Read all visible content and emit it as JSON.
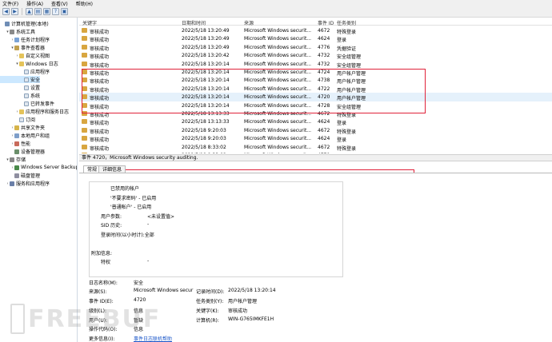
{
  "menu": [
    "文件(F)",
    "操作(A)",
    "查看(V)",
    "帮助(H)"
  ],
  "tree": [
    {
      "label": "计算机管理(本地)",
      "icon": "computer-icon",
      "indent": 0,
      "exp": ""
    },
    {
      "label": "系统工具",
      "icon": "tools-icon",
      "indent": 1,
      "exp": "▾"
    },
    {
      "label": "任务计划程序",
      "icon": "task-scheduler-icon",
      "indent": 2,
      "exp": "›"
    },
    {
      "label": "事件查看器",
      "icon": "event-viewer-icon",
      "indent": 2,
      "exp": "▾"
    },
    {
      "label": "自定义视图",
      "icon": "folder-icon",
      "indent": 3,
      "exp": "›"
    },
    {
      "label": "Windows 日志",
      "icon": "folder-icon",
      "indent": 3,
      "exp": "▾"
    },
    {
      "label": "应用程序",
      "icon": "log-icon",
      "indent": 4,
      "exp": ""
    },
    {
      "label": "安全",
      "icon": "log-icon",
      "indent": 4,
      "exp": "",
      "selected": true
    },
    {
      "label": "设置",
      "icon": "log-icon",
      "indent": 4,
      "exp": ""
    },
    {
      "label": "系统",
      "icon": "log-icon",
      "indent": 4,
      "exp": ""
    },
    {
      "label": "已转发事件",
      "icon": "log-icon",
      "indent": 4,
      "exp": ""
    },
    {
      "label": "应用程序和服务日志",
      "icon": "folder-icon",
      "indent": 3,
      "exp": "›"
    },
    {
      "label": "订阅",
      "icon": "log-icon",
      "indent": 3,
      "exp": ""
    },
    {
      "label": "共享文件夹",
      "icon": "shared-folder-icon",
      "indent": 2,
      "exp": "›"
    },
    {
      "label": "本地用户和组",
      "icon": "users-icon",
      "indent": 2,
      "exp": "›"
    },
    {
      "label": "性能",
      "icon": "performance-icon",
      "indent": 2,
      "exp": "›"
    },
    {
      "label": "设备管理器",
      "icon": "device-manager-icon",
      "indent": 2,
      "exp": ""
    },
    {
      "label": "存储",
      "icon": "storage-icon",
      "indent": 1,
      "exp": "▾"
    },
    {
      "label": "Windows Server Backup",
      "icon": "backup-icon",
      "indent": 2,
      "exp": "›"
    },
    {
      "label": "磁盘管理",
      "icon": "disk-icon",
      "indent": 2,
      "exp": ""
    },
    {
      "label": "服务和应用程序",
      "icon": "services-icon",
      "indent": 1,
      "exp": "›"
    }
  ],
  "columns": [
    "关键字",
    "日期和时间",
    "来源",
    "事件 ID",
    "任务类别"
  ],
  "events": [
    {
      "keyword": "审核成功",
      "datetime": "2022/5/18 13:20:49",
      "source": "Microsoft Windows securit...",
      "id": "4672",
      "category": "特殊登录"
    },
    {
      "keyword": "审核成功",
      "datetime": "2022/5/18 13:20:49",
      "source": "Microsoft Windows securit...",
      "id": "4624",
      "category": "登录"
    },
    {
      "keyword": "审核成功",
      "datetime": "2022/5/18 13:20:49",
      "source": "Microsoft Windows securit...",
      "id": "4776",
      "category": "凭据验证"
    },
    {
      "keyword": "审核成功",
      "datetime": "2022/5/18 13:20:42",
      "source": "Microsoft Windows securit...",
      "id": "4732",
      "category": "安全组管理"
    },
    {
      "keyword": "审核成功",
      "datetime": "2022/5/18 13:20:14",
      "source": "Microsoft Windows securit...",
      "id": "4732",
      "category": "安全组管理"
    },
    {
      "keyword": "审核成功",
      "datetime": "2022/5/18 13:20:14",
      "source": "Microsoft Windows securit...",
      "id": "4724",
      "category": "用户帐户管理"
    },
    {
      "keyword": "审核成功",
      "datetime": "2022/5/18 13:20:14",
      "source": "Microsoft Windows securit...",
      "id": "4738",
      "category": "用户帐户管理"
    },
    {
      "keyword": "审核成功",
      "datetime": "2022/5/18 13:20:14",
      "source": "Microsoft Windows securit...",
      "id": "4722",
      "category": "用户帐户管理"
    },
    {
      "keyword": "审核成功",
      "datetime": "2022/5/18 13:20:14",
      "source": "Microsoft Windows securit...",
      "id": "4720",
      "category": "用户帐户管理",
      "selected": true
    },
    {
      "keyword": "审核成功",
      "datetime": "2022/5/18 13:20:14",
      "source": "Microsoft Windows securit...",
      "id": "4728",
      "category": "安全组管理"
    },
    {
      "keyword": "审核成功",
      "datetime": "2022/5/18 13:13:33",
      "source": "Microsoft Windows securit...",
      "id": "4672",
      "category": "特殊登录"
    },
    {
      "keyword": "审核成功",
      "datetime": "2022/5/18 13:13:33",
      "source": "Microsoft Windows securit...",
      "id": "4624",
      "category": "登录"
    },
    {
      "keyword": "审核成功",
      "datetime": "2022/5/18 9:20:03",
      "source": "Microsoft Windows securit...",
      "id": "4672",
      "category": "特殊登录"
    },
    {
      "keyword": "审核成功",
      "datetime": "2022/5/18 9:20:03",
      "source": "Microsoft Windows securit...",
      "id": "4624",
      "category": "登录"
    },
    {
      "keyword": "审核成功",
      "datetime": "2022/5/18 8:33:02",
      "source": "Microsoft Windows securit...",
      "id": "4672",
      "category": "特殊登录"
    },
    {
      "keyword": "审核成功",
      "datetime": "2022/5/18 8:33:02",
      "source": "Microsoft Windows securit...",
      "id": "4779",
      "category": "其他登录/注销..."
    }
  ],
  "detail": {
    "title": "事件 4720，Microsoft Windows security auditing.",
    "tabs": [
      "常规",
      "详细信息"
    ],
    "description": [
      {
        "text": "已禁用的帐户",
        "indent": 2
      },
      {
        "text": "'不要求密码' - 已启用",
        "indent": 2
      },
      {
        "text": "'普通帐户' - 已启用",
        "indent": 2
      },
      {
        "text": "用户参数:",
        "indent": 1,
        "value": "<未设置值>"
      },
      {
        "text": "SID 历史:",
        "indent": 1,
        "value": "-"
      },
      {
        "text": "登录时间(以小时计):全部",
        "indent": 1
      },
      {
        "text": "",
        "indent": 0
      },
      {
        "text": "附加信息:",
        "indent": 0
      },
      {
        "text": "特权",
        "indent": 1,
        "value": "-"
      }
    ],
    "props": {
      "log_name_label": "日志名称(M):",
      "log_name": "安全",
      "source_label": "来源(S):",
      "source": "Microsoft Windows secur",
      "logged_label": "记录时间(D):",
      "logged": "2022/5/18 13:20:14",
      "event_id_label": "事件 ID(E):",
      "event_id": "4720",
      "task_label": "任务类别(Y):",
      "task": "用户帐户管理",
      "level_label": "级别(L):",
      "level": "信息",
      "keywords_label": "关键字(K):",
      "keywords": "审核成功",
      "user_label": "用户(U):",
      "user": "暂缺",
      "computer_label": "计算机(R):",
      "computer": "WIN-G765IMKFE1H",
      "opcode_label": "操作代码(O):",
      "opcode": "信息",
      "more_label": "更多信息(I):",
      "more_link": "事件日志联机帮助"
    }
  },
  "watermark": "FREEBUF",
  "colors": {
    "highlight": "#e0223a",
    "selection": "#cce8ff",
    "link": "#1a56c9"
  }
}
